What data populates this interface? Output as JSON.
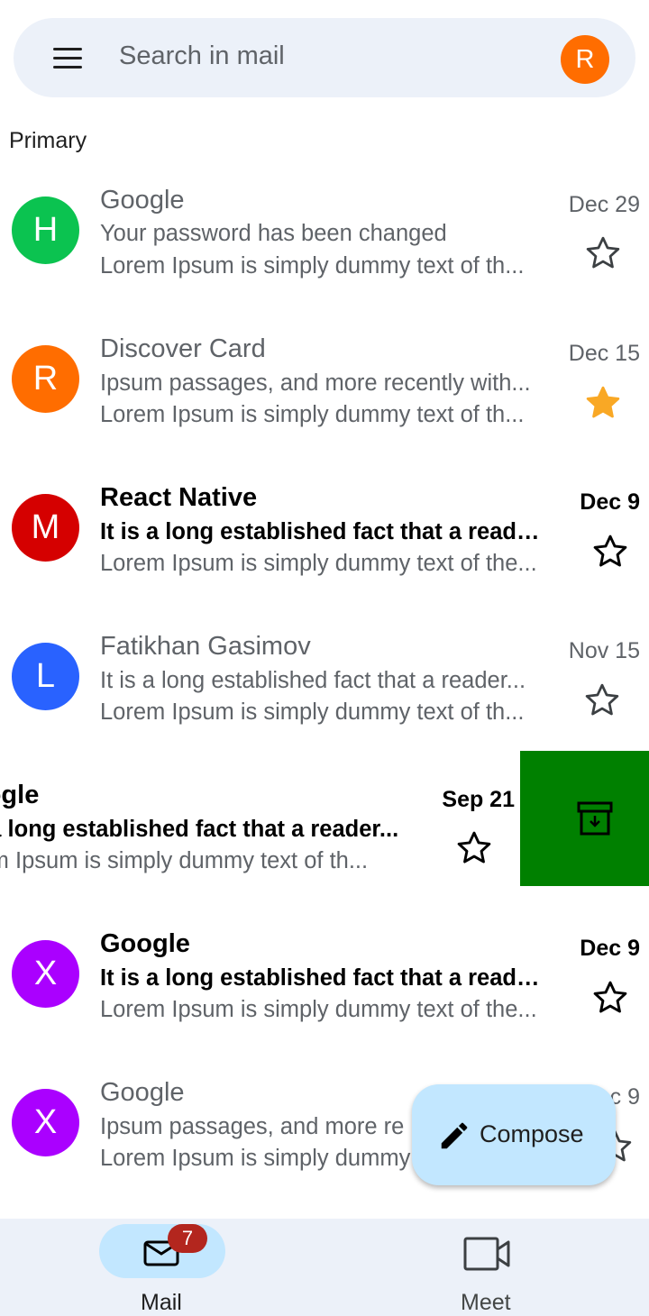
{
  "search": {
    "placeholder": "Search in mail",
    "account_initial": "R",
    "account_color": "#ff6d00"
  },
  "section_label": "Primary",
  "emails": [
    {
      "initial": "H",
      "avatar_color": "#0bc350",
      "sender": "Google",
      "subject": "Your password has been changed",
      "preview": "Lorem Ipsum is simply dummy text of th...",
      "date": "Dec 29",
      "starred": false,
      "unread": false
    },
    {
      "initial": "R",
      "avatar_color": "#ff6d00",
      "sender": "Discover Card",
      "subject": "Ipsum passages, and more recently with...",
      "preview": "Lorem Ipsum is simply dummy text of th...",
      "date": "Dec 15",
      "starred": true,
      "unread": false
    },
    {
      "initial": "M",
      "avatar_color": "#d50000",
      "sender": "React Native",
      "subject": "It is a long established fact that a reader...",
      "preview": "Lorem Ipsum is simply dummy text of the...",
      "date": "Dec 9",
      "starred": false,
      "unread": true
    },
    {
      "initial": "L",
      "avatar_color": "#2962ff",
      "sender": "Fatikhan Gasimov",
      "subject": "It is a long established fact that a reader...",
      "preview": "Lorem Ipsum is simply dummy text of th...",
      "date": "Nov 15",
      "starred": false,
      "unread": false
    },
    {
      "initial": "",
      "avatar_color": "",
      "sender": "oogle",
      "subject": "s a long established fact that a reader...",
      "preview": "rem Ipsum is simply dummy text of th...",
      "date": "Sep 21",
      "starred": false,
      "unread": true
    },
    {
      "initial": "X",
      "avatar_color": "#aa00ff",
      "sender": "Google",
      "subject": "It is a long established fact that a reader...",
      "preview": "Lorem Ipsum is simply dummy text of the...",
      "date": "Dec 9",
      "starred": false,
      "unread": true
    },
    {
      "initial": "X",
      "avatar_color": "#aa00ff",
      "sender": "Google",
      "subject": "Ipsum passages, and more re",
      "preview": "Lorem Ipsum is simply dummy",
      "date": "c 9",
      "starred": false,
      "unread": false
    }
  ],
  "swipe_action": {
    "icon": "archive-icon",
    "color": "#008000"
  },
  "compose": {
    "label": "Compose",
    "icon": "pencil-icon"
  },
  "bottom_nav": {
    "mail": {
      "label": "Mail",
      "badge": "7",
      "icon": "mail-icon"
    },
    "meet": {
      "label": "Meet",
      "icon": "video-camera-icon"
    }
  },
  "colors": {
    "star_filled": "#f9a825",
    "surface": "#ecf1f9",
    "accent_container": "#c2e7ff"
  }
}
